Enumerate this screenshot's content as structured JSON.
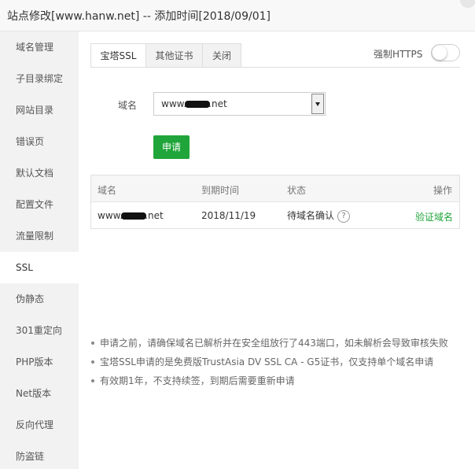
{
  "window": {
    "title": "站点修改[www.hanw.net] -- 添加时间[2018/09/01]"
  },
  "sidebar": {
    "items": [
      {
        "label": "域名管理"
      },
      {
        "label": "子目录绑定"
      },
      {
        "label": "网站目录"
      },
      {
        "label": "错误页"
      },
      {
        "label": "默认文档"
      },
      {
        "label": "配置文件"
      },
      {
        "label": "流量限制"
      },
      {
        "label": "SSL",
        "active": true
      },
      {
        "label": "伪静态"
      },
      {
        "label": "301重定向"
      },
      {
        "label": "PHP版本"
      },
      {
        "label": "Net版本"
      },
      {
        "label": "反向代理"
      },
      {
        "label": "防盗链"
      }
    ]
  },
  "tabs": [
    {
      "label": "宝塔SSL",
      "active": true
    },
    {
      "label": "其他证书"
    },
    {
      "label": "关闭"
    }
  ],
  "https": {
    "label": "强制HTTPS",
    "enabled": false
  },
  "form": {
    "domain_label": "域名",
    "domain_prefix": "www.",
    "domain_suffix": ".net",
    "apply_label": "申请"
  },
  "table": {
    "headers": [
      "域名",
      "到期时间",
      "状态",
      "操作"
    ],
    "rows": [
      {
        "domain_prefix": "www.",
        "domain_suffix": ".net",
        "expiry": "2018/11/19",
        "status": "待域名确认",
        "help": "?",
        "action": "验证域名"
      }
    ]
  },
  "notes": [
    "申请之前，请确保域名已解析并在安全组放行了443端口，如未解析会导致审核失败",
    "宝塔SSL申请的是免费版TrustAsia DV SSL CA - G5证书，仅支持单个域名申请",
    "有效期1年，不支持续签，到期后需要重新申请"
  ],
  "colors": {
    "accent": "#20a53a",
    "sidebar_bg": "#f2f2f2"
  }
}
